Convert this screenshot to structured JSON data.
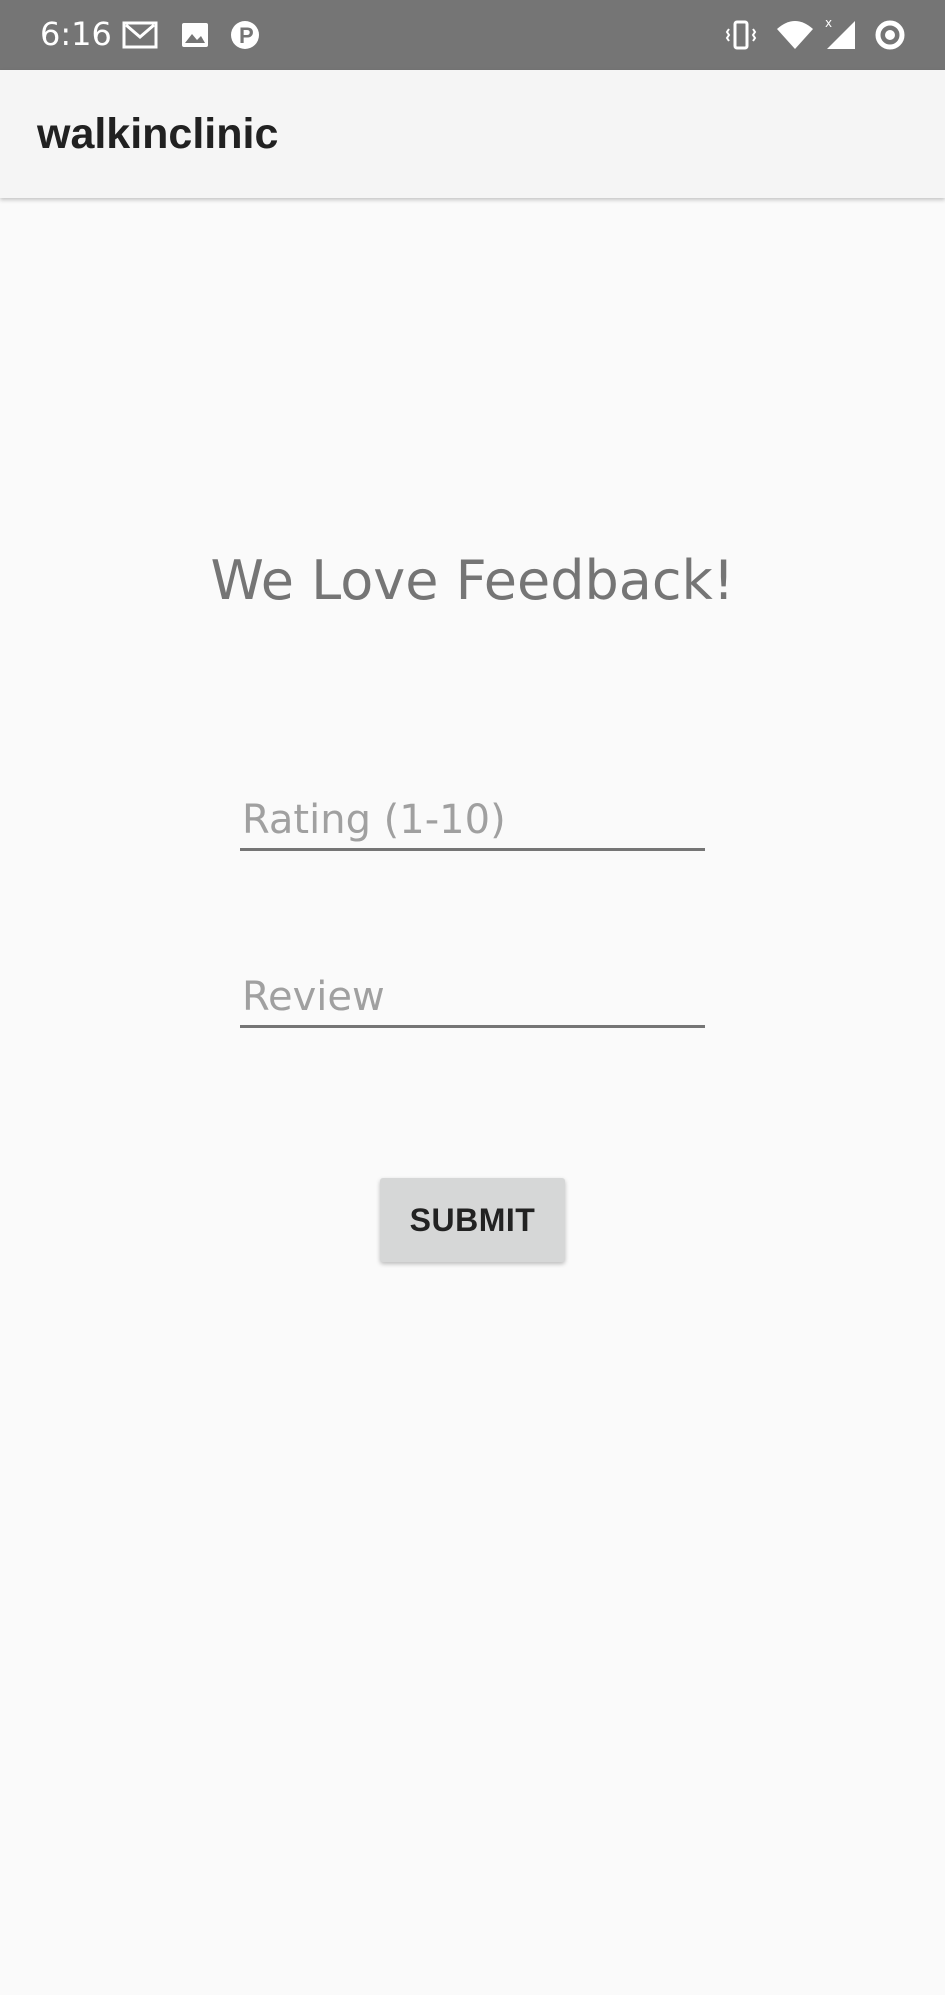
{
  "status_bar": {
    "time": "6:16",
    "left_icons": [
      "gmail-icon",
      "image-icon",
      "parking-icon"
    ],
    "right_icons": [
      "vibrate-icon",
      "wifi-icon",
      "signal-icon",
      "sync-icon"
    ],
    "background_color": "#757575"
  },
  "app_bar": {
    "title": "walkinclinic"
  },
  "main": {
    "heading": "We Love Feedback!",
    "rating_field": {
      "placeholder": "Rating (1-10)",
      "value": ""
    },
    "review_field": {
      "placeholder": "Review",
      "value": ""
    },
    "submit_label": "SUBMIT"
  }
}
